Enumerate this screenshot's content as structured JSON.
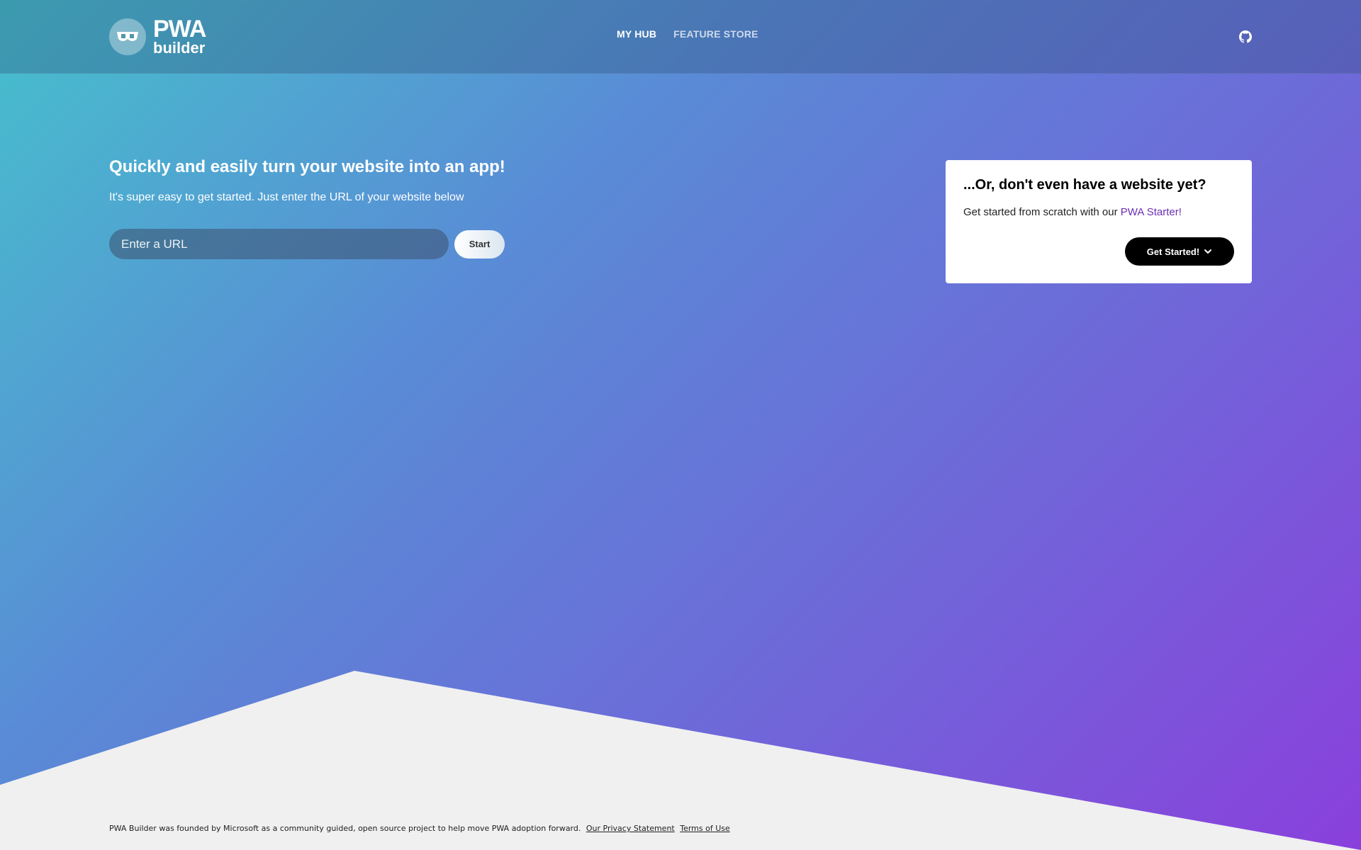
{
  "brand": {
    "line1": "PWA",
    "line2": "builder"
  },
  "nav": {
    "items": [
      {
        "label": "MY HUB",
        "active": true
      },
      {
        "label": "FEATURE STORE",
        "active": false
      }
    ]
  },
  "icons": {
    "github": "github-icon",
    "chevron": "chevron-down-icon"
  },
  "hero": {
    "title": "Quickly and easily turn your website into an app!",
    "subtitle": "It's super easy to get started. Just enter the URL of your website below",
    "url_placeholder": "Enter a URL",
    "start_label": "Start"
  },
  "card": {
    "title": "...Or, don't even have a website yet?",
    "text": "Get started from scratch with our",
    "link": "PWA Starter!",
    "button_label": "Get Started!"
  },
  "footer": {
    "text": "PWA Builder was founded by Microsoft as a community guided, open source project to help move PWA adoption forward.",
    "privacy": "Our Privacy Statement",
    "terms": "Terms of Use"
  },
  "colors": {
    "gradient_start": "#46c0cc",
    "gradient_end": "#8a40dc",
    "wave": "#f0f0f0",
    "link": "#6b2fb0"
  }
}
